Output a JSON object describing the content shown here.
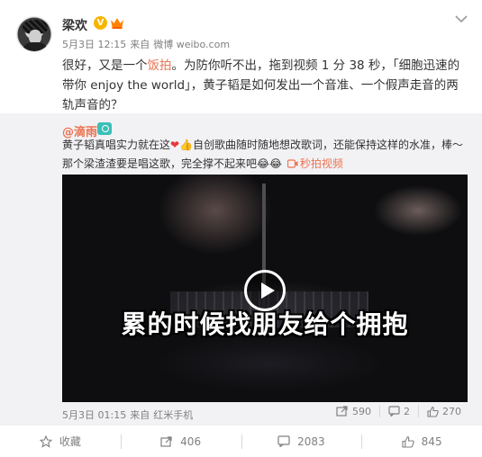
{
  "post": {
    "username": "梁欢",
    "verified_badge": "V",
    "date": "5月3日 12:15",
    "source_prefix": "来自",
    "source": "微博 weibo.com",
    "text_before": "很好，又是一个",
    "text_highlight": "饭拍",
    "text_after": "。为防你听不出，拖到视频 1 分 38 秒，「细胞迅速的带你 enjoy the world」，黄子韬是如何发出一个音准、一个假声走音的两轨声音的？"
  },
  "repost": {
    "username": "@滴雨",
    "text_part1": "黄子韬真唱实力就在这",
    "text_part2": "自创歌曲随时随地想改歌词，还能保持这样的水准，棒～那个梁渣渣要是唱这歌，完全撑不起来吧",
    "emoji_heart": "❤",
    "emoji_thumb": "👍",
    "emoji_laugh": "😂😂",
    "video_link": "秒拍视频",
    "video_caption": "累的时候找朋友给个拥抱",
    "date": "5月3日 01:15",
    "source_prefix": "来自",
    "source": "红米手机",
    "reposts": "590",
    "comments": "2",
    "likes": "270"
  },
  "footer": {
    "favorite": "收藏",
    "reposts": "406",
    "comments": "2083",
    "likes": "845"
  },
  "colors": {
    "accent": "#eb7350",
    "badge": "#f7b500",
    "muted": "#808080",
    "repost_bg": "#f2f2f5"
  }
}
